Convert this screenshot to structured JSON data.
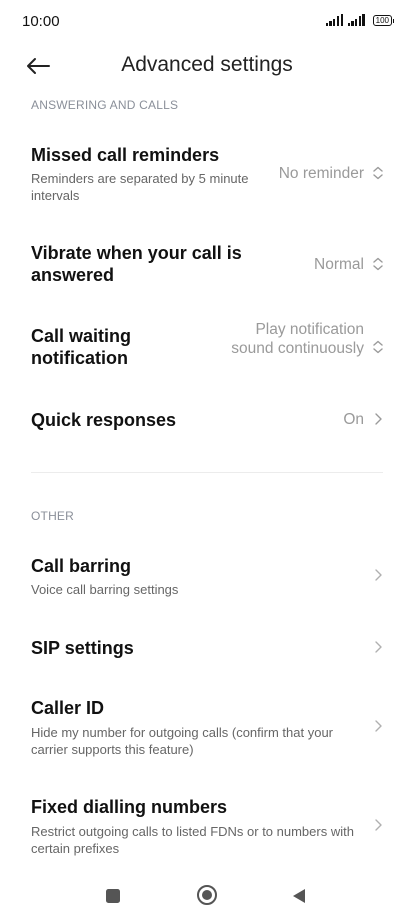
{
  "status": {
    "time": "10:00",
    "battery": "100"
  },
  "header": {
    "title": "Advanced settings"
  },
  "sections": {
    "answering": "ANSWERING AND CALLS",
    "other": "OTHER"
  },
  "rows": {
    "missed": {
      "title": "Missed call reminders",
      "subtitle": "Reminders are separated by 5 minute intervals",
      "value": "No reminder"
    },
    "vibrate": {
      "title": "Vibrate when your call is answered",
      "value": "Normal"
    },
    "waiting": {
      "title": "Call waiting notification",
      "value": "Play notification sound continuously"
    },
    "quick": {
      "title": "Quick responses",
      "value": "On"
    },
    "barring": {
      "title": "Call barring",
      "subtitle": "Voice call barring settings"
    },
    "sip": {
      "title": "SIP settings"
    },
    "callerid": {
      "title": "Caller ID",
      "subtitle": "Hide my number for outgoing calls (confirm that your carrier supports this feature)"
    },
    "fdn": {
      "title": "Fixed dialling numbers",
      "subtitle": "Restrict outgoing calls to listed FDNs or to numbers with certain prefixes"
    }
  }
}
